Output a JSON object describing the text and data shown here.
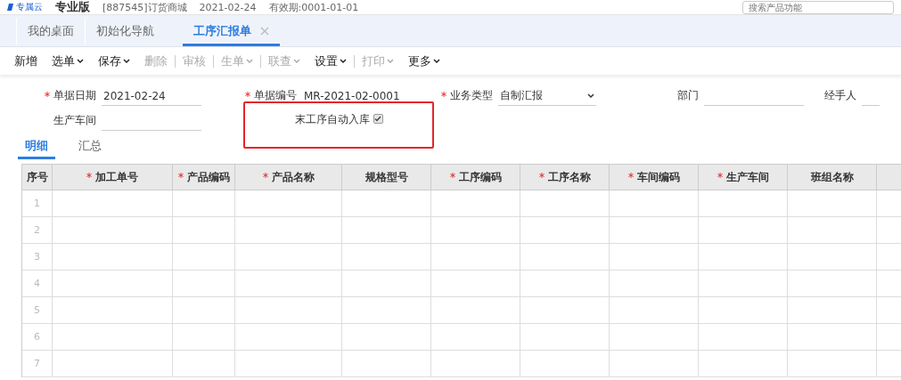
{
  "header": {
    "brand": "专属云",
    "product": "专业版",
    "account": "[887545]订货商城",
    "date": "2021-02-24",
    "validity": "有效期:0001-01-01",
    "search": {
      "placeholder": "搜索产品功能"
    }
  },
  "tabs": [
    {
      "label": "我的桌面",
      "selected": false,
      "closable": false
    },
    {
      "label": "初始化导航",
      "selected": false,
      "closable": false
    },
    {
      "label": "工序汇报单",
      "selected": true,
      "closable": true
    }
  ],
  "toolbar": [
    {
      "kind": "button",
      "label": "新增",
      "has_menu": false,
      "disabled": false
    },
    {
      "kind": "button",
      "label": "选单",
      "has_menu": true,
      "disabled": false
    },
    {
      "kind": "button",
      "label": "保存",
      "has_menu": true,
      "disabled": false
    },
    {
      "kind": "button",
      "label": "删除",
      "has_menu": false,
      "disabled": true
    },
    {
      "kind": "separator"
    },
    {
      "kind": "button",
      "label": "审核",
      "has_menu": false,
      "disabled": true
    },
    {
      "kind": "separator"
    },
    {
      "kind": "button",
      "label": "生单",
      "has_menu": true,
      "disabled": true
    },
    {
      "kind": "separator"
    },
    {
      "kind": "button",
      "label": "联查",
      "has_menu": true,
      "disabled": true
    },
    {
      "kind": "button",
      "label": "设置",
      "has_menu": true,
      "disabled": false
    },
    {
      "kind": "separator"
    },
    {
      "kind": "button",
      "label": "打印",
      "has_menu": true,
      "disabled": true
    },
    {
      "kind": "button",
      "label": "更多",
      "has_menu": true,
      "disabled": false
    }
  ],
  "form": {
    "row_1": [
      {
        "label": "单据日期",
        "required": true,
        "value": "2021-02-24",
        "kind": "text"
      },
      {
        "label": "单据编号",
        "required": true,
        "value": "MR-2021-02-0001",
        "kind": "plain"
      },
      {
        "label": "业务类型",
        "required": true,
        "value": "自制汇报",
        "kind": "select"
      },
      {
        "label": "部门",
        "required": false,
        "kind": "text"
      },
      {
        "label": "经手人",
        "required": false,
        "kind": "text"
      }
    ],
    "workshop": {
      "label": "生产车间",
      "required": false
    },
    "auto_stock": {
      "label": "末工序自动入库",
      "checked": true,
      "highlighted": true
    }
  },
  "detail_tabs": [
    {
      "label": "明细",
      "selected": true
    },
    {
      "label": "汇总",
      "selected": false
    }
  ],
  "table": {
    "columns": [
      {
        "label": "序号",
        "required": false
      },
      {
        "label": "加工单号",
        "required": true
      },
      {
        "label": "产品编码",
        "required": true
      },
      {
        "label": "产品名称",
        "required": true
      },
      {
        "label": "规格型号",
        "required": false
      },
      {
        "label": "工序编码",
        "required": true
      },
      {
        "label": "工序名称",
        "required": true
      },
      {
        "label": "车间编码",
        "required": true
      },
      {
        "label": "生产车间",
        "required": true
      },
      {
        "label": "班组名称",
        "required": false
      }
    ],
    "rows": [
      "1",
      "2",
      "3",
      "4",
      "5",
      "6",
      "7"
    ]
  }
}
